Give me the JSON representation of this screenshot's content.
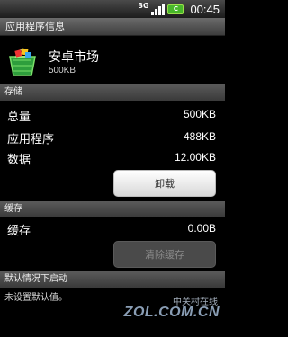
{
  "status_bar": {
    "network": "3G",
    "battery": "C",
    "time": "00:45",
    "battery_color": "#48b72b"
  },
  "title_bar": {
    "title": "应用程序信息"
  },
  "app": {
    "name": "安卓市场",
    "size": "500KB"
  },
  "storage": {
    "header": "存储",
    "rows": [
      {
        "label": "总量",
        "value": "500KB"
      },
      {
        "label": "应用程序",
        "value": "488KB"
      },
      {
        "label": "数据",
        "value": "12.00KB"
      }
    ],
    "uninstall_label": "卸载"
  },
  "cache": {
    "header": "缓存",
    "label": "缓存",
    "value": "0.00B",
    "clear_label": "清除缓存"
  },
  "defaults": {
    "header": "默认情况下启动",
    "text": "未设置默认值。"
  },
  "watermark": {
    "line1": "中关村在线",
    "line2": "ZOL.COM.CN"
  }
}
